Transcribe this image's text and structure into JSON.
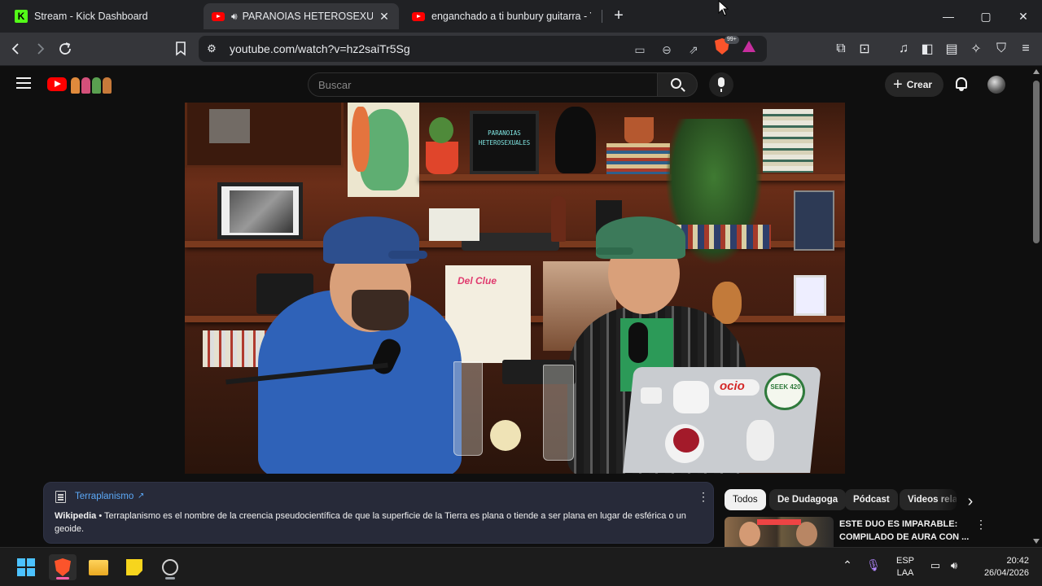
{
  "browser": {
    "tabs": [
      {
        "title": "Stream - Kick Dashboard",
        "icon": "kick-icon",
        "active": false
      },
      {
        "title": "PARANOIAS HETEROSEXUALES",
        "icon": "youtube-icon",
        "active": true,
        "audio": true
      },
      {
        "title": "enganchado a ti bunbury guitarra - Yo",
        "icon": "youtube-icon",
        "active": false
      }
    ],
    "new_tab": "+",
    "window_controls": {
      "minimize": "—",
      "maximize": "▢",
      "close": "✕"
    },
    "url": "youtube.com/watch?v=hz2saiTr5Sg",
    "shields_badge": "99+",
    "colors": {
      "tabstrip": "#202124",
      "toolbar": "#35363a",
      "brave_orange": "#fb542b"
    }
  },
  "youtube": {
    "search_placeholder": "Buscar",
    "create_label": "Crear",
    "video": {
      "poster_text": "PARANOIAS\nHETEROSEXUALES",
      "sticker_ocio": "ocio",
      "sticker_seek": "SEEK 420",
      "sticker_del_clue": "Del Clue"
    },
    "info_panel": {
      "title": "Terraplanismo",
      "source": "Wikipedia",
      "separator": "•",
      "description": "Terraplanismo es el nombre de la creencia pseudocientífica de que la superficie de la Tierra es plana o tiende a ser plana en lugar de esférica o un geoide."
    },
    "chips": [
      "Todos",
      "De Dudagoga",
      "Pódcast",
      "Videos relacionados"
    ],
    "recommendation": {
      "title": "ESTE DUO ES IMPARABLE: COMPILADO DE AURA CON ..."
    },
    "colors": {
      "brand_red": "#ff0000",
      "background": "#0f0f0f",
      "link": "#5ca9f8"
    }
  },
  "taskbar": {
    "language": "ESP",
    "layout": "LAA",
    "time": "20:42",
    "date": "26/04/2026"
  }
}
